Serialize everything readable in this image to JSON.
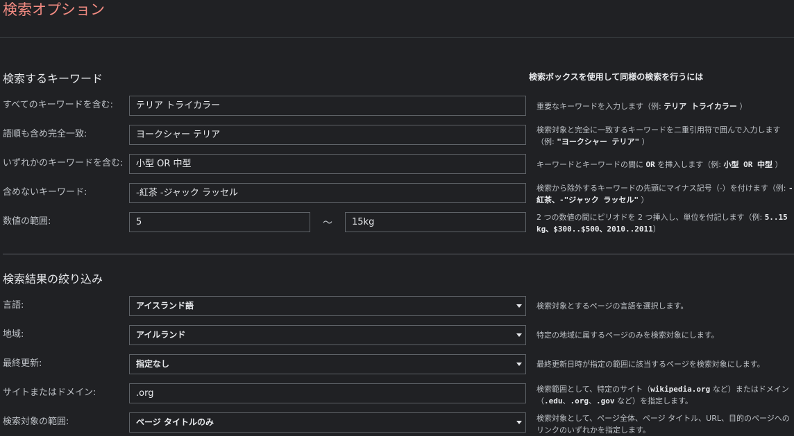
{
  "page_title": "検索オプション",
  "keywords_section": {
    "title": "検索するキーワード",
    "side_heading": "検索ボックスを使用して同様の検索を行うには",
    "rows": [
      {
        "label": "すべてのキーワードを含む:",
        "value": "テリア トライカラー",
        "help_pre": "重要なキーワードを入力します（例: ",
        "help_code": "テリア トライカラー",
        "help_post": " ）"
      },
      {
        "label": "語順も含め完全一致:",
        "value": "ヨークシャー テリア",
        "help_pre": "検索対象と完全に一致するキーワードを二重引用符で囲んで入力します（例: ",
        "help_code": "\"ヨークシャー テリア\"",
        "help_post": " ）"
      },
      {
        "label": "いずれかのキーワードを含む:",
        "value": "小型 OR 中型",
        "help_pre": "キーワードとキーワードの間に ",
        "help_code": "OR",
        "help_mid": " を挿入します（例: ",
        "help_code2": "小型 OR 中型",
        "help_post": " ）"
      },
      {
        "label": "含めないキーワード:",
        "value": "-紅茶 -ジャック ラッセル",
        "help_pre": "検索から除外するキーワードの先頭にマイナス記号（-）を付けます（例: ",
        "help_code": "-紅茶、-\"ジャック ラッセル\"",
        "help_post": " ）"
      }
    ],
    "range": {
      "label": "数値の範囲:",
      "from": "5",
      "tilde": "〜",
      "to": "15kg",
      "help_pre": "2 つの数値の間にピリオドを 2 つ挿入し、単位を付記します（例: ",
      "help_code": "5..15 kg、$300..$500、2010..2011",
      "help_post": "）"
    }
  },
  "narrow_section": {
    "title": "検索結果の絞り込み",
    "rows": [
      {
        "label": "言語:",
        "value": "アイスランド語",
        "type": "select",
        "help": "検索対象とするページの言語を選択します。"
      },
      {
        "label": "地域:",
        "value": "アイルランド",
        "type": "select",
        "help": "特定の地域に属するページのみを検索対象にします。"
      },
      {
        "label": "最終更新:",
        "value": "指定なし",
        "type": "select",
        "help": "最終更新日時が指定の範囲に該当するページを検索対象にします。"
      },
      {
        "label": "サイトまたはドメイン:",
        "value": ".org",
        "type": "input",
        "help_pre": "検索範囲として、特定のサイト（",
        "help_code": "wikipedia.org",
        "help_mid": " など）またはドメイン（",
        "help_code2": ".edu",
        "help_sep1": "、",
        "help_code3": ".org",
        "help_sep2": "、",
        "help_code4": ".gov",
        "help_post": " など）を指定します。"
      },
      {
        "label": "検索対象の範囲:",
        "value": "ページ タイトルのみ",
        "type": "select",
        "help": "検索対象として、ページ全体、ページ タイトル、URL、目的のページへのリンクのいずれかを指定します。"
      }
    ]
  }
}
